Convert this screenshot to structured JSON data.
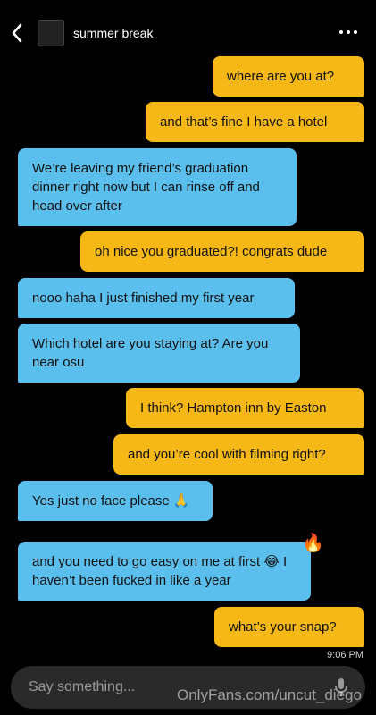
{
  "header": {
    "title": "summer break",
    "back_icon": "chevron-left-icon",
    "more_icon": "more-horizontal-icon"
  },
  "messages": [
    {
      "dir": "out",
      "text": "where are you at?"
    },
    {
      "dir": "out",
      "text": "and that’s fine I have a hotel"
    },
    {
      "dir": "in",
      "text": "We’re leaving my friend’s graduation dinner right now but I can rinse off and head over after"
    },
    {
      "dir": "out",
      "text": "oh nice you graduated?! congrats dude"
    },
    {
      "dir": "in",
      "text": "nooo haha I just finished my first year"
    },
    {
      "dir": "in",
      "text": "Which hotel are you staying at? Are you near osu"
    },
    {
      "dir": "out",
      "text": "I think? Hampton inn by Easton"
    },
    {
      "dir": "out",
      "text": "and you’re cool with filming right?"
    },
    {
      "dir": "in",
      "text": "Yes just no face please 🙏"
    },
    {
      "dir": "in",
      "text": "and you need to go easy on me at first 😂 I haven’t been fucked in like a year"
    },
    {
      "dir": "out",
      "text": "what’s your snap?"
    }
  ],
  "reaction": "🔥",
  "timestamp": "9:06 PM",
  "composer": {
    "placeholder": "Say something...",
    "mic_icon": "microphone-icon"
  },
  "watermark": "OnlyFans.com/uncut_diego",
  "colors": {
    "outgoing": "#f5b816",
    "incoming": "#5bbfee",
    "background": "#000000"
  }
}
